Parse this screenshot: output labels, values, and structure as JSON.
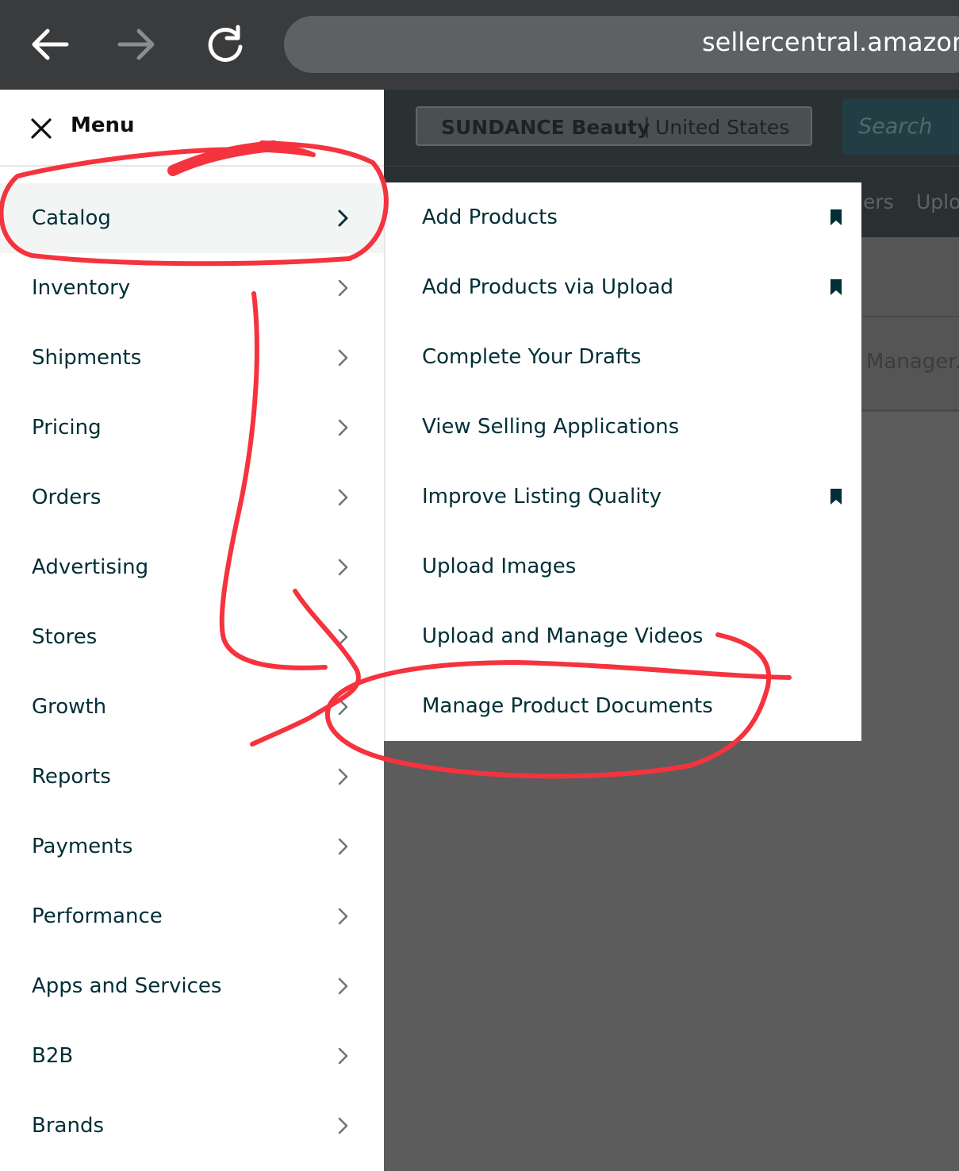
{
  "browser": {
    "url": "sellercentral.amazon.",
    "icons": [
      "back-arrow-icon",
      "forward-arrow-icon",
      "reload-icon"
    ]
  },
  "page_header": {
    "store_name": "SUNDANCE Beauty",
    "separator": "|",
    "store_region": "United States",
    "search_placeholder": "Search",
    "subnav_partial_1": "ers",
    "subnav_partial_2": "Uplo",
    "manager_partial": "Manager."
  },
  "menu": {
    "title": "Menu",
    "items": [
      {
        "label": "Catalog"
      },
      {
        "label": "Inventory"
      },
      {
        "label": "Shipments"
      },
      {
        "label": "Pricing"
      },
      {
        "label": "Orders"
      },
      {
        "label": "Advertising"
      },
      {
        "label": "Stores"
      },
      {
        "label": "Growth"
      },
      {
        "label": "Reports"
      },
      {
        "label": "Payments"
      },
      {
        "label": "Performance"
      },
      {
        "label": "Apps and Services"
      },
      {
        "label": "B2B"
      },
      {
        "label": "Brands"
      }
    ]
  },
  "submenu": {
    "items": [
      {
        "label": "Add Products",
        "bookmarked": true
      },
      {
        "label": "Add Products via Upload",
        "bookmarked": true
      },
      {
        "label": "Complete Your Drafts",
        "bookmarked": false
      },
      {
        "label": "View Selling Applications",
        "bookmarked": false
      },
      {
        "label": "Improve Listing Quality",
        "bookmarked": true
      },
      {
        "label": "Upload Images",
        "bookmarked": false
      },
      {
        "label": "Upload and Manage Videos",
        "bookmarked": false
      },
      {
        "label": "Manage Product Documents",
        "bookmarked": false
      }
    ]
  },
  "colors": {
    "menu_text": "#002f36",
    "annotation_red": "#f5333f",
    "browser_bar": "#393b3d",
    "overlay": "#5c5c5c"
  }
}
